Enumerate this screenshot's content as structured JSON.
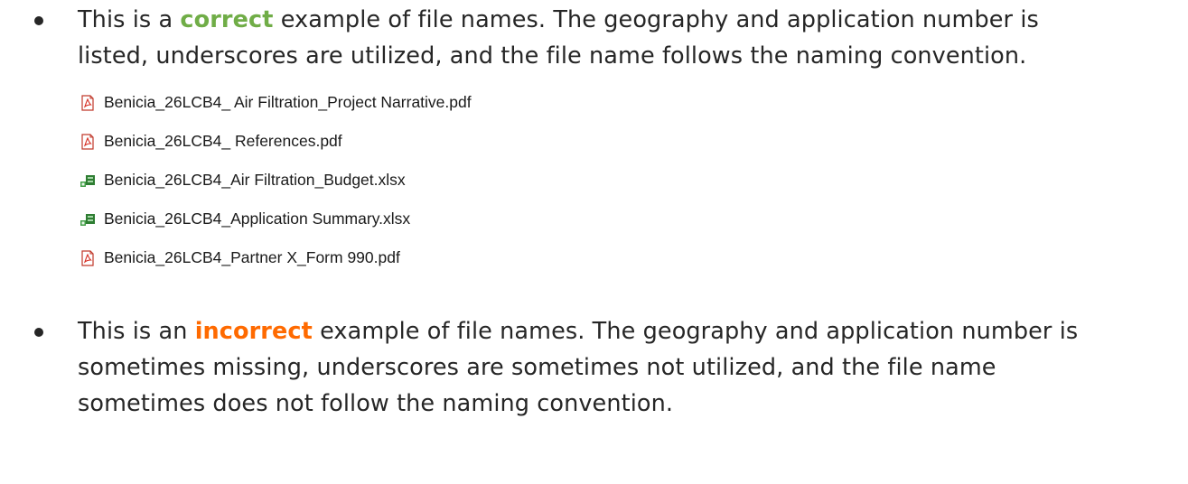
{
  "bullets": [
    {
      "prefix": "This is a ",
      "keyword": "correct",
      "keyword_color": "#70ad47",
      "line1_rest": " example of file names. The geography and application number is",
      "line2": "listed, underscores are utilized, and the file name follows the naming convention."
    },
    {
      "prefix": "This is an ",
      "keyword": "incorrect",
      "keyword_color": "#ff6a00",
      "line1_rest": " example of file names. The geography and application number is",
      "line2": "sometimes missing, underscores are sometimes not utilized, and the file name",
      "line3": "sometimes does not follow the naming convention."
    }
  ],
  "files": [
    {
      "name": "Benicia_26LCB4_ Air Filtration_Project Narrative.pdf",
      "icon": "pdf-file-icon"
    },
    {
      "name": "Benicia_26LCB4_ References.pdf",
      "icon": "pdf-file-icon"
    },
    {
      "name": "Benicia_26LCB4_Air Filtration_Budget.xlsx",
      "icon": "excel-file-icon"
    },
    {
      "name": "Benicia_26LCB4_Application Summary.xlsx",
      "icon": "excel-file-icon"
    },
    {
      "name": "Benicia_26LCB4_Partner X_Form 990.pdf",
      "icon": "pdf-file-icon"
    }
  ]
}
